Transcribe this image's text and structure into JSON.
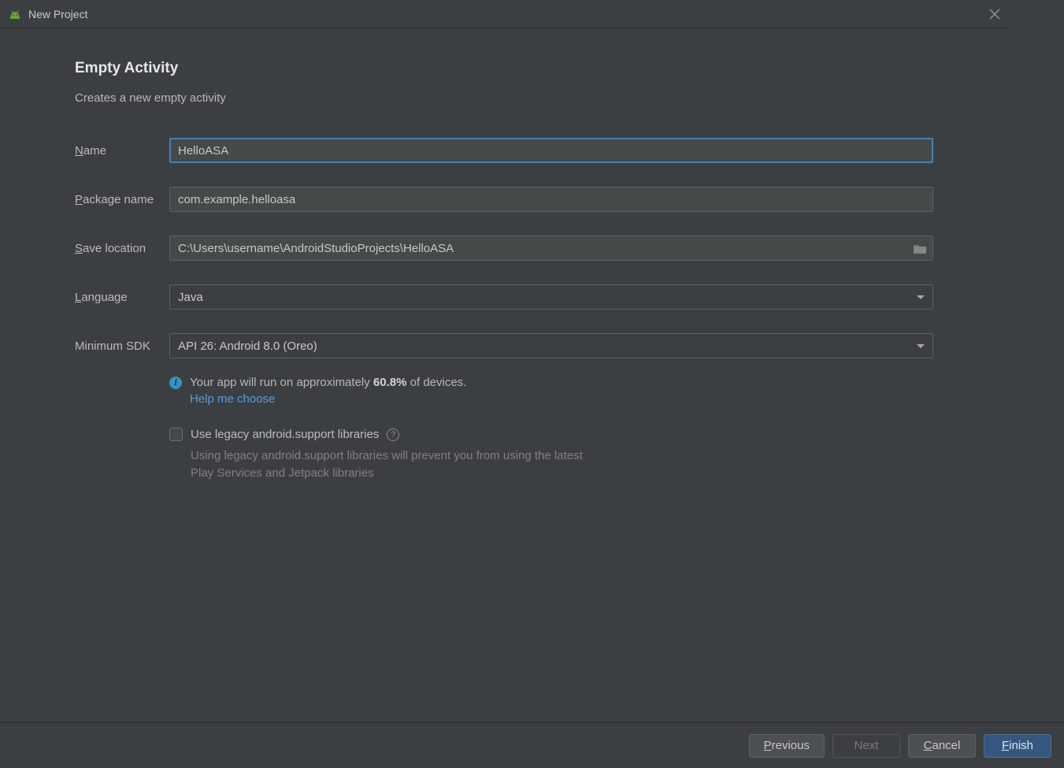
{
  "window": {
    "title": "New Project"
  },
  "heading": "Empty Activity",
  "subtitle": "Creates a new empty activity",
  "labels": {
    "name": "Name",
    "name_mn": "N",
    "package": "Package name",
    "package_mn": "P",
    "save": "Save location",
    "save_mn": "S",
    "language": "Language",
    "language_mn": "L",
    "minsdk": "Minimum SDK"
  },
  "fields": {
    "name": "HelloASA",
    "package": "com.example.helloasa",
    "save": "C:\\Users\\username\\AndroidStudioProjects\\HelloASA",
    "language": "Java",
    "minsdk": "API 26: Android 8.0 (Oreo)"
  },
  "info": {
    "prefix": "Your app will run on approximately ",
    "percent": "60.8%",
    "suffix": " of devices.",
    "help_link": "Help me choose"
  },
  "legacy": {
    "label": "Use legacy android.support libraries",
    "description": "Using legacy android.support libraries will prevent you from using the latest Play Services and Jetpack libraries",
    "checked": false
  },
  "buttons": {
    "previous": "Previous",
    "previous_mn": "P",
    "next": "Next",
    "cancel": "Cancel",
    "cancel_mn": "C",
    "finish": "Finish",
    "finish_mn": "F"
  }
}
